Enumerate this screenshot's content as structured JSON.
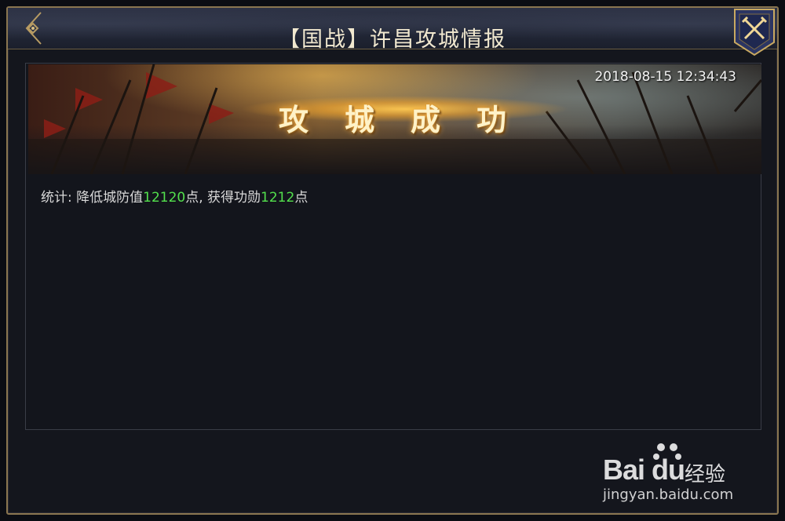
{
  "window": {
    "title": "【国战】许昌攻城情报"
  },
  "controls": {
    "back_icon": "diamond-arrow-left-icon",
    "close_icon": "crossed-swords-close-icon"
  },
  "banner": {
    "title": "攻城成功",
    "timestamp": "2018-08-15 12:34:43"
  },
  "stats": {
    "prefix": "统计: 降低城防值",
    "defense_value": "12120",
    "mid": "点, 获得功勋",
    "merit_value": "1212",
    "suffix": "点"
  },
  "watermark": {
    "logo": "Bai du",
    "sub": "经验",
    "url": "jingyan.baidu.com"
  },
  "colors": {
    "accent_gold": "#8a7650",
    "highlight_green": "#53e04d",
    "title_text": "#f1e8cf"
  }
}
